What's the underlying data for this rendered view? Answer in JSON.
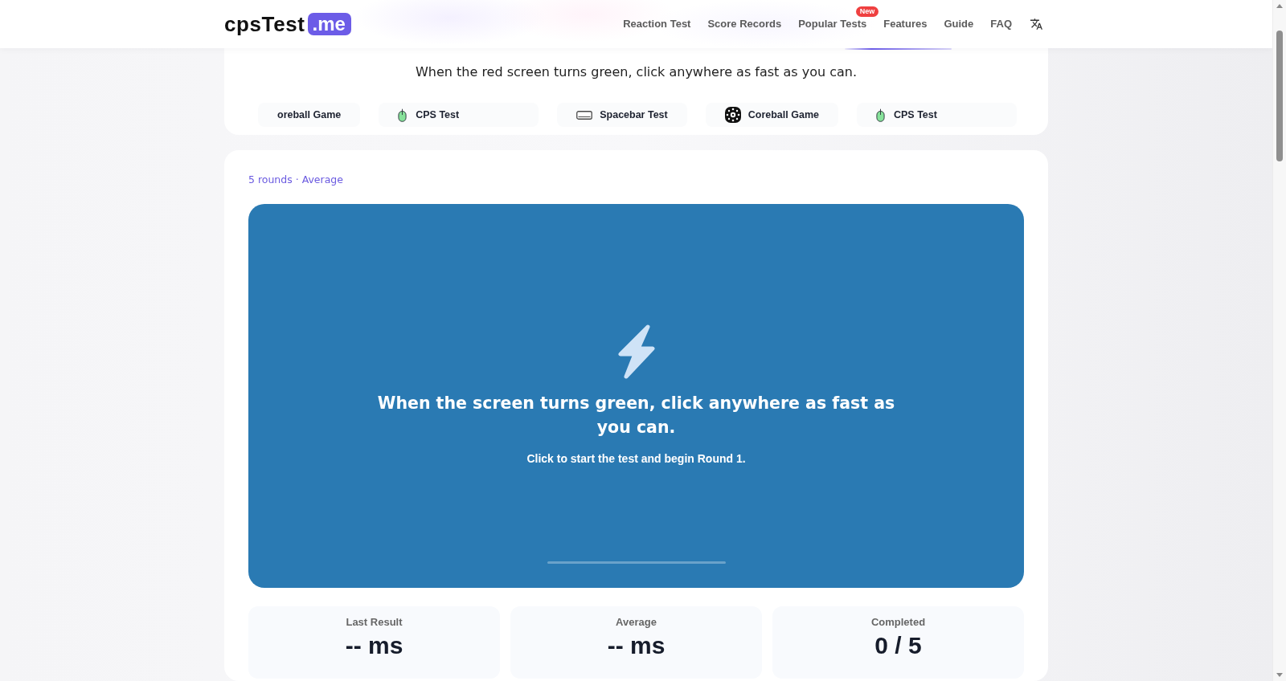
{
  "header": {
    "logo": {
      "text": "cpsTest",
      "badge": ".me"
    },
    "nav": [
      {
        "label": "Reaction Test"
      },
      {
        "label": "Score Records"
      },
      {
        "label": "Popular Tests",
        "badge": "New"
      },
      {
        "label": "Features"
      },
      {
        "label": "Guide"
      },
      {
        "label": "FAQ"
      }
    ]
  },
  "intro": {
    "subtitle": "When the red screen turns green, click anywhere as fast as you can.",
    "tests": [
      {
        "label": "oreball Game",
        "kind": "text-only"
      },
      {
        "label": "CPS Test",
        "kind": "mouse"
      },
      {
        "label": "Spacebar Test",
        "kind": "keyboard"
      },
      {
        "label": "Coreball Game",
        "kind": "coreball"
      },
      {
        "label": "CPS Test",
        "kind": "mouse"
      }
    ]
  },
  "test": {
    "mode": "5 rounds · Average",
    "panel": {
      "started": false,
      "heading": "When the screen turns green, click anywhere as fast as you can.",
      "hint": "Click to start the test and begin Round 1."
    },
    "stats": [
      {
        "label": "Last Result",
        "value": "-- ms"
      },
      {
        "label": "Average",
        "value": "-- ms"
      },
      {
        "label": "Completed",
        "value": "0 / 5"
      }
    ]
  }
}
